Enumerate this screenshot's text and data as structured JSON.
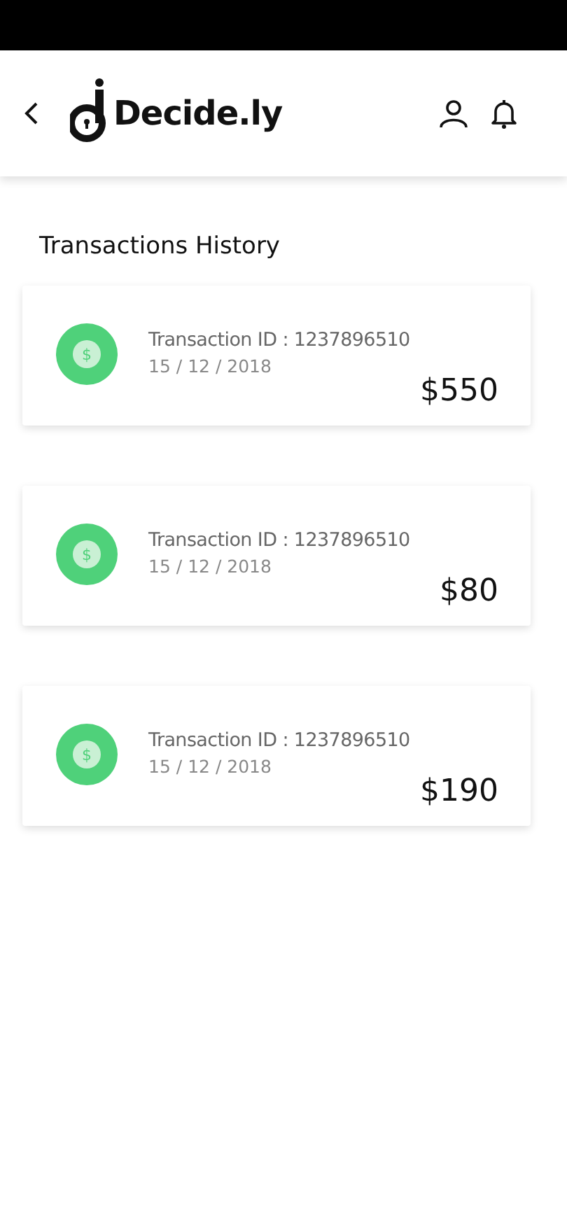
{
  "header": {
    "logo_text": "Decide.ly"
  },
  "section_title": "Transactions History",
  "transactions": [
    {
      "coin_symbol": "$",
      "transaction_id": "Transaction ID : 1237896510",
      "date": "15 / 12 / 2018",
      "amount": "$550"
    },
    {
      "coin_symbol": "$",
      "transaction_id": "Transaction ID : 1237896510",
      "date": "15 / 12 / 2018",
      "amount": "$80"
    },
    {
      "coin_symbol": "$",
      "transaction_id": "Transaction ID : 1237896510",
      "date": "15 / 12 / 2018",
      "amount": "$190"
    }
  ]
}
